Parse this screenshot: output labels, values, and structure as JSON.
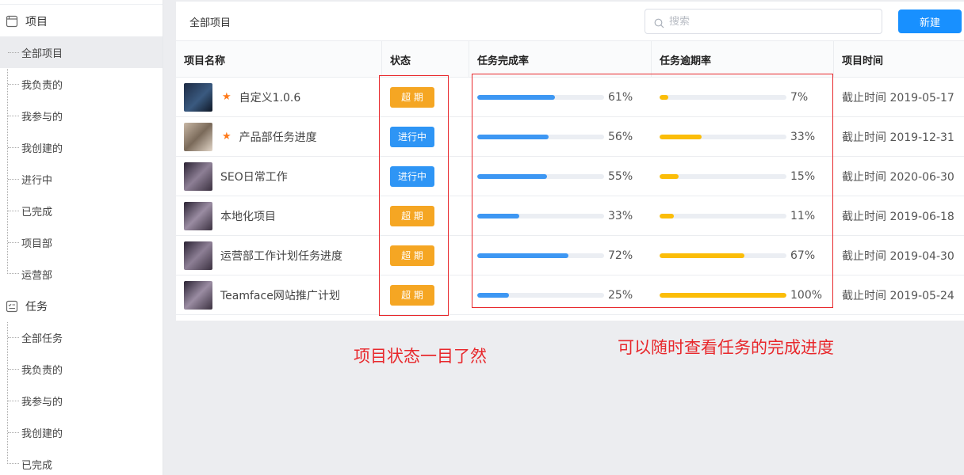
{
  "sidebar": {
    "groups": [
      {
        "label": "项目",
        "icon": "window-icon",
        "items": [
          "全部项目",
          "我负责的",
          "我参与的",
          "我创建的",
          "进行中",
          "已完成",
          "项目部",
          "运营部"
        ]
      },
      {
        "label": "任务",
        "icon": "task-list-icon",
        "items": [
          "全部任务",
          "我负责的",
          "我参与的",
          "我创建的",
          "已完成"
        ]
      }
    ],
    "active_item": "全部项目"
  },
  "header": {
    "title": "全部项目",
    "search_placeholder": "搜索",
    "new_button": "新建"
  },
  "table": {
    "columns": [
      "项目名称",
      "状态",
      "任务完成率",
      "任务逾期率",
      "项目时间"
    ],
    "rows": [
      {
        "name": "自定义1.0.6",
        "starred": true,
        "status": "超 期",
        "status_type": "overdue",
        "completion": 61,
        "completion_text": "61%",
        "overdue": 7,
        "overdue_text": "7%",
        "date": "截止时间 2019-05-17"
      },
      {
        "name": "产品部任务进度",
        "starred": true,
        "status": "进行中",
        "status_type": "in-progress",
        "completion": 56,
        "completion_text": "56%",
        "overdue": 33,
        "overdue_text": "33%",
        "date": "截止时间 2019-12-31"
      },
      {
        "name": "SEO日常工作",
        "starred": false,
        "status": "进行中",
        "status_type": "in-progress",
        "completion": 55,
        "completion_text": "55%",
        "overdue": 15,
        "overdue_text": "15%",
        "date": "截止时间 2020-06-30"
      },
      {
        "name": "本地化项目",
        "starred": false,
        "status": "超 期",
        "status_type": "overdue",
        "completion": 33,
        "completion_text": "33%",
        "overdue": 11,
        "overdue_text": "11%",
        "date": "截止时间 2019-06-18"
      },
      {
        "name": "运营部工作计划任务进度",
        "starred": false,
        "status": "超 期",
        "status_type": "overdue",
        "completion": 72,
        "completion_text": "72%",
        "overdue": 67,
        "overdue_text": "67%",
        "date": "截止时间 2019-04-30"
      },
      {
        "name": "Teamface网站推广计划",
        "starred": false,
        "status": "超 期",
        "status_type": "overdue",
        "completion": 25,
        "completion_text": "25%",
        "overdue": 100,
        "overdue_text": "100%",
        "date": "截止时间 2019-05-24"
      }
    ]
  },
  "annotations": {
    "status_note": "项目状态一目了然",
    "progress_note": "可以随时查看任务的完成进度"
  },
  "colors": {
    "primary": "#1890ff",
    "overdue_badge": "#f5a623",
    "in_progress_badge": "#2e95f5",
    "completion_bar": "#3d97f3",
    "overdue_bar": "#fbbd08",
    "annotation_red": "#e8282c",
    "star": "#ff7a1a"
  }
}
